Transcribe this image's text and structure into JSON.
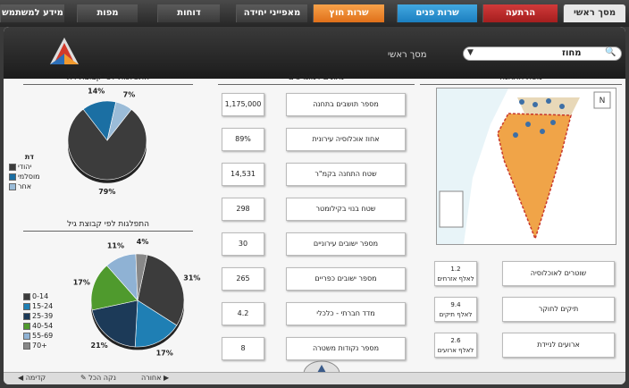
{
  "tabs": {
    "info": "מידע למשתמש",
    "maps": "מפות",
    "reports": "דוחות",
    "unit": "מאפייני יחידה",
    "external": "שרות חוץ",
    "internal": "שרות פנים",
    "alert": "הרתעה",
    "home": "מסך ראשי"
  },
  "header": {
    "home_label": "מסך ראשי",
    "search_value": "מחוז",
    "search_icon": "search-icon",
    "dropdown_icon": "chevron-down-icon"
  },
  "sections": {
    "religion": "התפלגות לפי קבוצת דת",
    "demographics": "נתונים דמוגרפים",
    "station_map": "מפת התחנה",
    "age": "התפלגות לפי קבוצת גיל"
  },
  "demographics": [
    {
      "label": "מספר תושבים בתחנה",
      "value": "1,175,000"
    },
    {
      "label": "אחוז אוכלוסיה עירונית",
      "value": "89%"
    },
    {
      "label": "שטח התחנה בקמ\"ר",
      "value": "14,531"
    },
    {
      "label": "שטח בנוי בקילומטר",
      "value": "298"
    },
    {
      "label": "מספר ישובים עירוניים",
      "value": "30"
    },
    {
      "label": "מספר ישובים כפריים",
      "value": "265"
    },
    {
      "label": "מדד חברתי - כלכלי",
      "value": "4.2"
    },
    {
      "label": "מספר נקודות משטרה",
      "value": "8"
    }
  ],
  "stats": [
    {
      "label": "שוטרים לאוכלוסיה",
      "value": "1.2",
      "unit": "לאלף אזרחים"
    },
    {
      "label": "תיקים לחוקר",
      "value": "9.4",
      "unit": "לאלף תיקים"
    },
    {
      "label": "ארועים לניידת",
      "value": "2.6",
      "unit": "לאלף ארועים"
    }
  ],
  "religion_legend_title": "דת",
  "chart_data": [
    {
      "type": "pie",
      "title": "התפלגות לפי קבוצת דת",
      "categories": [
        "יהודי",
        "מוסלמי",
        "אחר"
      ],
      "values": [
        79,
        14,
        7
      ],
      "value_labels": [
        "79%",
        "14%",
        "7%"
      ],
      "colors": [
        "#3c3c3c",
        "#1b6fa3",
        "#9bbcd8"
      ]
    },
    {
      "type": "pie",
      "title": "התפלגות לפי קבוצת גיל",
      "categories": [
        "0-14",
        "15-24",
        "25-39",
        "40-54",
        "55-69",
        "70+"
      ],
      "values": [
        31,
        17,
        21,
        17,
        11,
        4
      ],
      "value_labels": [
        "31%",
        "17%",
        "21%",
        "17%",
        "11%",
        "4%"
      ],
      "colors": [
        "#3c3c3c",
        "#1f7fb4",
        "#1c3a58",
        "#4f9a2d",
        "#8fb2d4",
        "#888888"
      ]
    }
  ],
  "footer": {
    "prev": "קדימה",
    "clear": "נקה הכל",
    "back": "אחורה"
  }
}
